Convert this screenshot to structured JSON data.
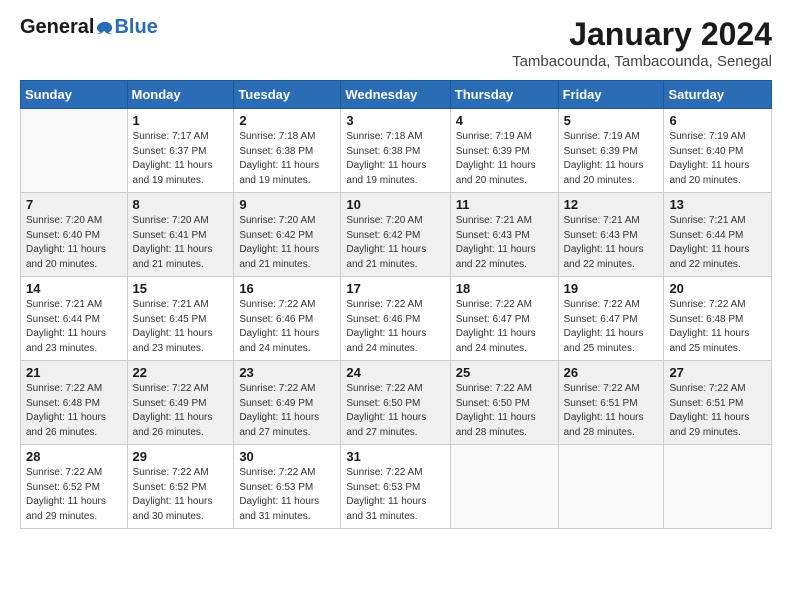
{
  "logo": {
    "general": "General",
    "blue": "Blue"
  },
  "header": {
    "month": "January 2024",
    "location": "Tambacounda, Tambacounda, Senegal"
  },
  "weekdays": [
    "Sunday",
    "Monday",
    "Tuesday",
    "Wednesday",
    "Thursday",
    "Friday",
    "Saturday"
  ],
  "weeks": [
    [
      {
        "num": "",
        "info": ""
      },
      {
        "num": "1",
        "info": "Sunrise: 7:17 AM\nSunset: 6:37 PM\nDaylight: 11 hours\nand 19 minutes."
      },
      {
        "num": "2",
        "info": "Sunrise: 7:18 AM\nSunset: 6:38 PM\nDaylight: 11 hours\nand 19 minutes."
      },
      {
        "num": "3",
        "info": "Sunrise: 7:18 AM\nSunset: 6:38 PM\nDaylight: 11 hours\nand 19 minutes."
      },
      {
        "num": "4",
        "info": "Sunrise: 7:19 AM\nSunset: 6:39 PM\nDaylight: 11 hours\nand 20 minutes."
      },
      {
        "num": "5",
        "info": "Sunrise: 7:19 AM\nSunset: 6:39 PM\nDaylight: 11 hours\nand 20 minutes."
      },
      {
        "num": "6",
        "info": "Sunrise: 7:19 AM\nSunset: 6:40 PM\nDaylight: 11 hours\nand 20 minutes."
      }
    ],
    [
      {
        "num": "7",
        "info": "Sunrise: 7:20 AM\nSunset: 6:40 PM\nDaylight: 11 hours\nand 20 minutes."
      },
      {
        "num": "8",
        "info": "Sunrise: 7:20 AM\nSunset: 6:41 PM\nDaylight: 11 hours\nand 21 minutes."
      },
      {
        "num": "9",
        "info": "Sunrise: 7:20 AM\nSunset: 6:42 PM\nDaylight: 11 hours\nand 21 minutes."
      },
      {
        "num": "10",
        "info": "Sunrise: 7:20 AM\nSunset: 6:42 PM\nDaylight: 11 hours\nand 21 minutes."
      },
      {
        "num": "11",
        "info": "Sunrise: 7:21 AM\nSunset: 6:43 PM\nDaylight: 11 hours\nand 22 minutes."
      },
      {
        "num": "12",
        "info": "Sunrise: 7:21 AM\nSunset: 6:43 PM\nDaylight: 11 hours\nand 22 minutes."
      },
      {
        "num": "13",
        "info": "Sunrise: 7:21 AM\nSunset: 6:44 PM\nDaylight: 11 hours\nand 22 minutes."
      }
    ],
    [
      {
        "num": "14",
        "info": "Sunrise: 7:21 AM\nSunset: 6:44 PM\nDaylight: 11 hours\nand 23 minutes."
      },
      {
        "num": "15",
        "info": "Sunrise: 7:21 AM\nSunset: 6:45 PM\nDaylight: 11 hours\nand 23 minutes."
      },
      {
        "num": "16",
        "info": "Sunrise: 7:22 AM\nSunset: 6:46 PM\nDaylight: 11 hours\nand 24 minutes."
      },
      {
        "num": "17",
        "info": "Sunrise: 7:22 AM\nSunset: 6:46 PM\nDaylight: 11 hours\nand 24 minutes."
      },
      {
        "num": "18",
        "info": "Sunrise: 7:22 AM\nSunset: 6:47 PM\nDaylight: 11 hours\nand 24 minutes."
      },
      {
        "num": "19",
        "info": "Sunrise: 7:22 AM\nSunset: 6:47 PM\nDaylight: 11 hours\nand 25 minutes."
      },
      {
        "num": "20",
        "info": "Sunrise: 7:22 AM\nSunset: 6:48 PM\nDaylight: 11 hours\nand 25 minutes."
      }
    ],
    [
      {
        "num": "21",
        "info": "Sunrise: 7:22 AM\nSunset: 6:48 PM\nDaylight: 11 hours\nand 26 minutes."
      },
      {
        "num": "22",
        "info": "Sunrise: 7:22 AM\nSunset: 6:49 PM\nDaylight: 11 hours\nand 26 minutes."
      },
      {
        "num": "23",
        "info": "Sunrise: 7:22 AM\nSunset: 6:49 PM\nDaylight: 11 hours\nand 27 minutes."
      },
      {
        "num": "24",
        "info": "Sunrise: 7:22 AM\nSunset: 6:50 PM\nDaylight: 11 hours\nand 27 minutes."
      },
      {
        "num": "25",
        "info": "Sunrise: 7:22 AM\nSunset: 6:50 PM\nDaylight: 11 hours\nand 28 minutes."
      },
      {
        "num": "26",
        "info": "Sunrise: 7:22 AM\nSunset: 6:51 PM\nDaylight: 11 hours\nand 28 minutes."
      },
      {
        "num": "27",
        "info": "Sunrise: 7:22 AM\nSunset: 6:51 PM\nDaylight: 11 hours\nand 29 minutes."
      }
    ],
    [
      {
        "num": "28",
        "info": "Sunrise: 7:22 AM\nSunset: 6:52 PM\nDaylight: 11 hours\nand 29 minutes."
      },
      {
        "num": "29",
        "info": "Sunrise: 7:22 AM\nSunset: 6:52 PM\nDaylight: 11 hours\nand 30 minutes."
      },
      {
        "num": "30",
        "info": "Sunrise: 7:22 AM\nSunset: 6:53 PM\nDaylight: 11 hours\nand 31 minutes."
      },
      {
        "num": "31",
        "info": "Sunrise: 7:22 AM\nSunset: 6:53 PM\nDaylight: 11 hours\nand 31 minutes."
      },
      {
        "num": "",
        "info": ""
      },
      {
        "num": "",
        "info": ""
      },
      {
        "num": "",
        "info": ""
      }
    ]
  ]
}
